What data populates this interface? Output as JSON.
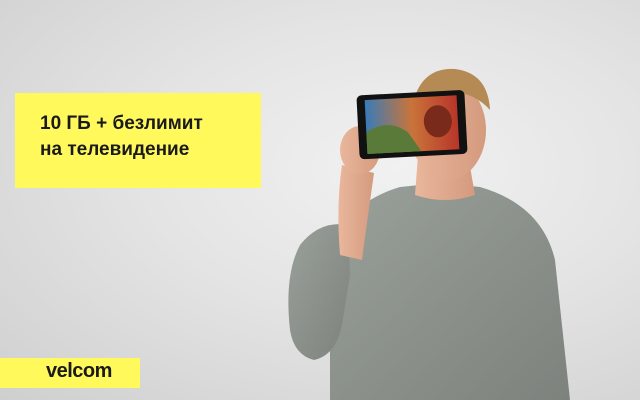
{
  "headline": {
    "line1": "10 ГБ + безлимит",
    "line2": "на телевидение"
  },
  "logo": {
    "text": "velcom"
  },
  "colors": {
    "accent_yellow": "#fff95c",
    "background": "#e4e4e4",
    "shirt": "#8f948f",
    "text": "#1a1a1a"
  },
  "image": {
    "subject": "person-holding-tablet-icon"
  }
}
